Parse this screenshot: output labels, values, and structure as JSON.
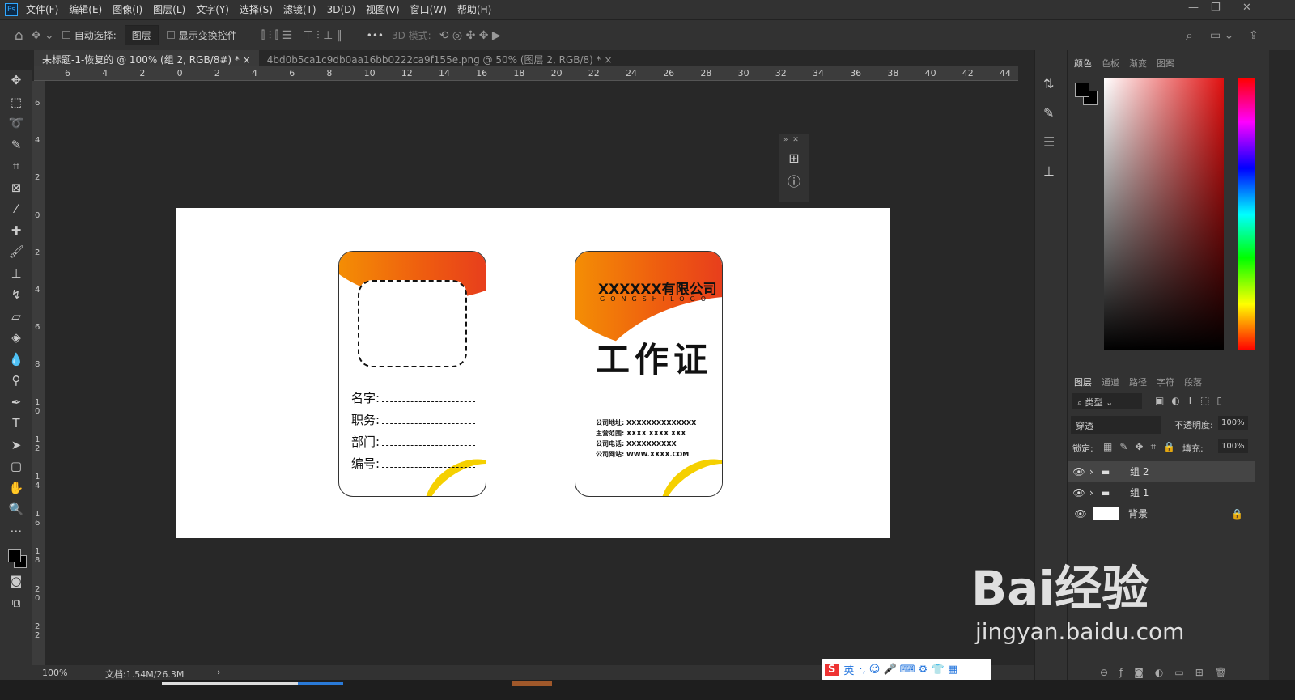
{
  "menu": [
    "文件(F)",
    "编辑(E)",
    "图像(I)",
    "图层(L)",
    "文字(Y)",
    "选择(S)",
    "滤镜(T)",
    "3D(D)",
    "视图(V)",
    "窗口(W)",
    "帮助(H)"
  ],
  "app_logo": "Ps",
  "options": {
    "auto_select": "自动选择:",
    "layer_select": "图层",
    "show_transform": "显示变换控件",
    "more": "•••",
    "mode3d": "3D 模式:"
  },
  "tabs": [
    {
      "label": "未标题-1-恢复的 @ 100% (组 2, RGB/8#) *"
    },
    {
      "label": "4bd0b5ca1c9db0aa16bb0222ca9f155e.png @ 50% (图层 2, RGB/8) *"
    }
  ],
  "ruler_top": [
    "6",
    "4",
    "2",
    "0",
    "2",
    "4",
    "6",
    "8",
    "10",
    "12",
    "14",
    "16",
    "18",
    "20",
    "22",
    "24",
    "26",
    "28",
    "30",
    "32",
    "34",
    "36",
    "38",
    "40",
    "42",
    "44"
  ],
  "ruler_left": [
    "6",
    "4",
    "2",
    "0",
    "2",
    "4",
    "6",
    "8",
    "10",
    "12",
    "14",
    "16",
    "18",
    "20",
    "22"
  ],
  "card_front": {
    "fields": [
      "名字:",
      "职务:",
      "部门:",
      "编号:"
    ]
  },
  "card_back": {
    "company": "XXXXXX有限公司",
    "logo_text": "GONGSHILOGO",
    "title": "工作证",
    "info": [
      "公司地址: XXXXXXXXXXXXXX",
      "主营范围: XXXX XXXX   XXX",
      "公司电话: XXXXXXXXXX",
      "公司网站: WWW.XXXX.COM"
    ]
  },
  "color_panel": {
    "tabs": [
      "颜色",
      "色板",
      "渐变",
      "图案"
    ]
  },
  "layers_panel": {
    "tabs": [
      "图层",
      "通道",
      "路径",
      "字符",
      "段落"
    ],
    "filter": "类型",
    "blend": "穿透",
    "opacity_label": "不透明度:",
    "opacity": "100%",
    "lock_label": "锁定:",
    "fill_label": "填充:",
    "fill": "100%",
    "layers": [
      {
        "name": "组 2",
        "type": "group",
        "selected": true
      },
      {
        "name": "组 1",
        "type": "group"
      },
      {
        "name": "背景",
        "type": "background",
        "locked": true
      }
    ]
  },
  "status": {
    "zoom": "100%",
    "doc": "文档:1.54M/26.3M"
  },
  "ime": {
    "lang": "英"
  },
  "watermark": {
    "brand": "Bai经验",
    "url": "jingyan.baidu.com"
  }
}
